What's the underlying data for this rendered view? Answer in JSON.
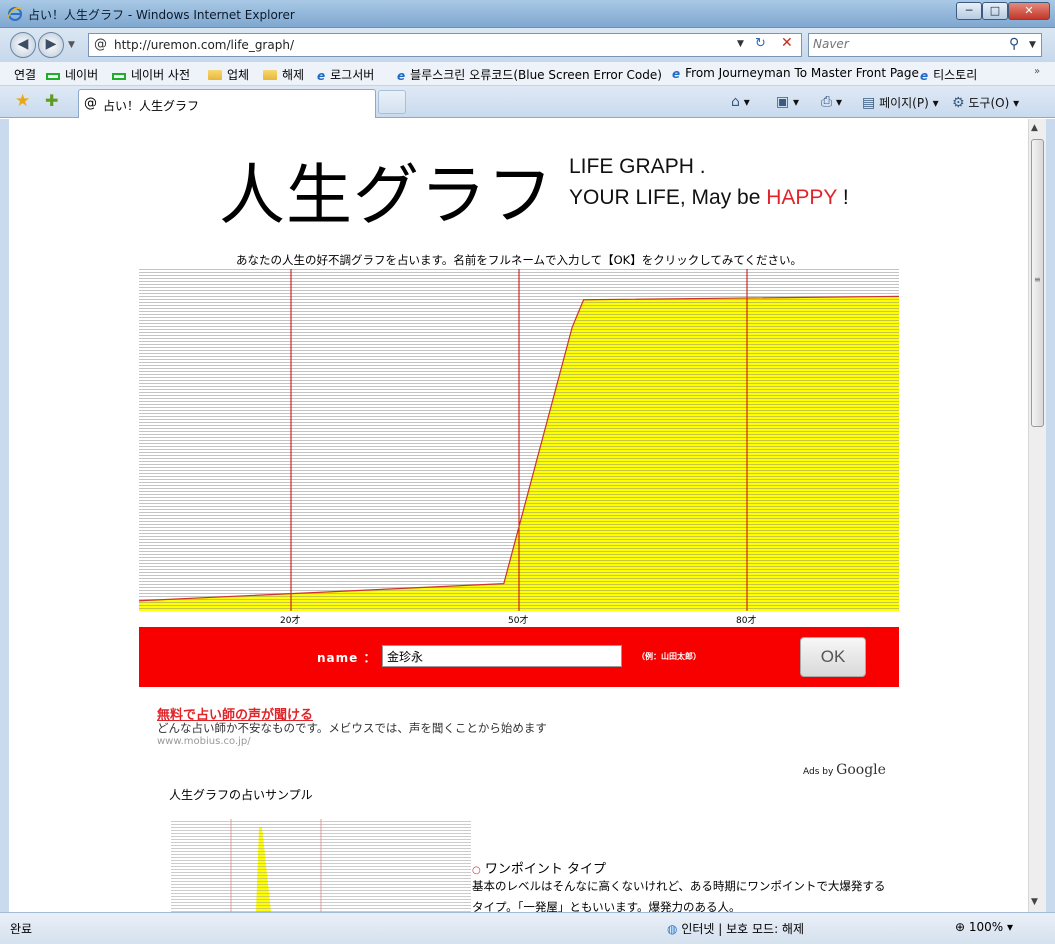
{
  "window": {
    "title": "占い！人生グラフ - Windows Internet Explorer",
    "min": "─",
    "max": "□",
    "close": "✕"
  },
  "address": {
    "url": "http://uremon.com/life_graph/",
    "search_placeholder": "Naver"
  },
  "links": {
    "label": "연결",
    "items": [
      {
        "label": "네이버",
        "icon": "green-box-icon"
      },
      {
        "label": "네이버 사전",
        "icon": "green-box-icon"
      },
      {
        "label": "업체",
        "icon": "folder-icon"
      },
      {
        "label": "해제",
        "icon": "folder-icon"
      },
      {
        "label": "로그서버",
        "icon": "ie-icon"
      },
      {
        "label": "블루스크린 오류코드(Blue Screen Error Code)",
        "icon": "ie-icon"
      },
      {
        "label": "From Journeyman To Master Front Page",
        "icon": "ie-icon"
      },
      {
        "label": "티스토리",
        "icon": "ie-icon"
      }
    ],
    "more": "»"
  },
  "tabs": {
    "active_label": "占い！人生グラフ",
    "commands": {
      "page": "페이지(P)",
      "tools": "도구(O)"
    }
  },
  "page": {
    "hero_title": "人生グラフ",
    "hero_sub1": "LIFE GRAPH .",
    "hero_sub2_pre": "YOUR LIFE, May be ",
    "hero_sub2_happy": "HAPPY",
    "hero_sub2_post": " !",
    "intro": "あなたの人生の好不調グラフを占います。名前をフルネームで入力して【OK】をクリックしてみてください。",
    "age_labels": [
      "20才",
      "50才",
      "80才"
    ],
    "name_label": "name ：",
    "name_value": "金珍永",
    "example": "（例：山田太郎）",
    "ok": "OK",
    "ad_title": "無料で占い師の声が聞ける",
    "ad_desc": "どんな占い師か不安なものです。メビウスでは、声を聞くことから始めます",
    "ad_url": "www.mobius.co.jp/",
    "ads_by": "Ads by ",
    "ads_google": "Google",
    "sample_title": "人生グラフの占いサンプル",
    "sample_type": "ワンポイント タイプ",
    "sample_desc1": "基本のレベルはそんなに高くないけれど、ある時期にワンポイントで大爆発する",
    "sample_desc2": "タイプ。「一発屋」ともいいます。爆発力のある人。"
  },
  "chart_data": {
    "type": "area",
    "x": [
      0,
      48,
      57,
      58.5,
      100
    ],
    "y": [
      3,
      8,
      83,
      91,
      92
    ],
    "x_tick_labels": [
      "20才",
      "50才",
      "80才"
    ],
    "fill_color": "#ffff00",
    "line_color": "#cc3333",
    "vline_color": "#cc0000",
    "grid": true
  },
  "status": {
    "done": "완료",
    "zone": "인터넷 | 보호 모드: 해제",
    "zoom": "100%"
  },
  "colors": {
    "banner": "#f80000",
    "happy": "#e0242a",
    "chrome": "#c9daee"
  }
}
